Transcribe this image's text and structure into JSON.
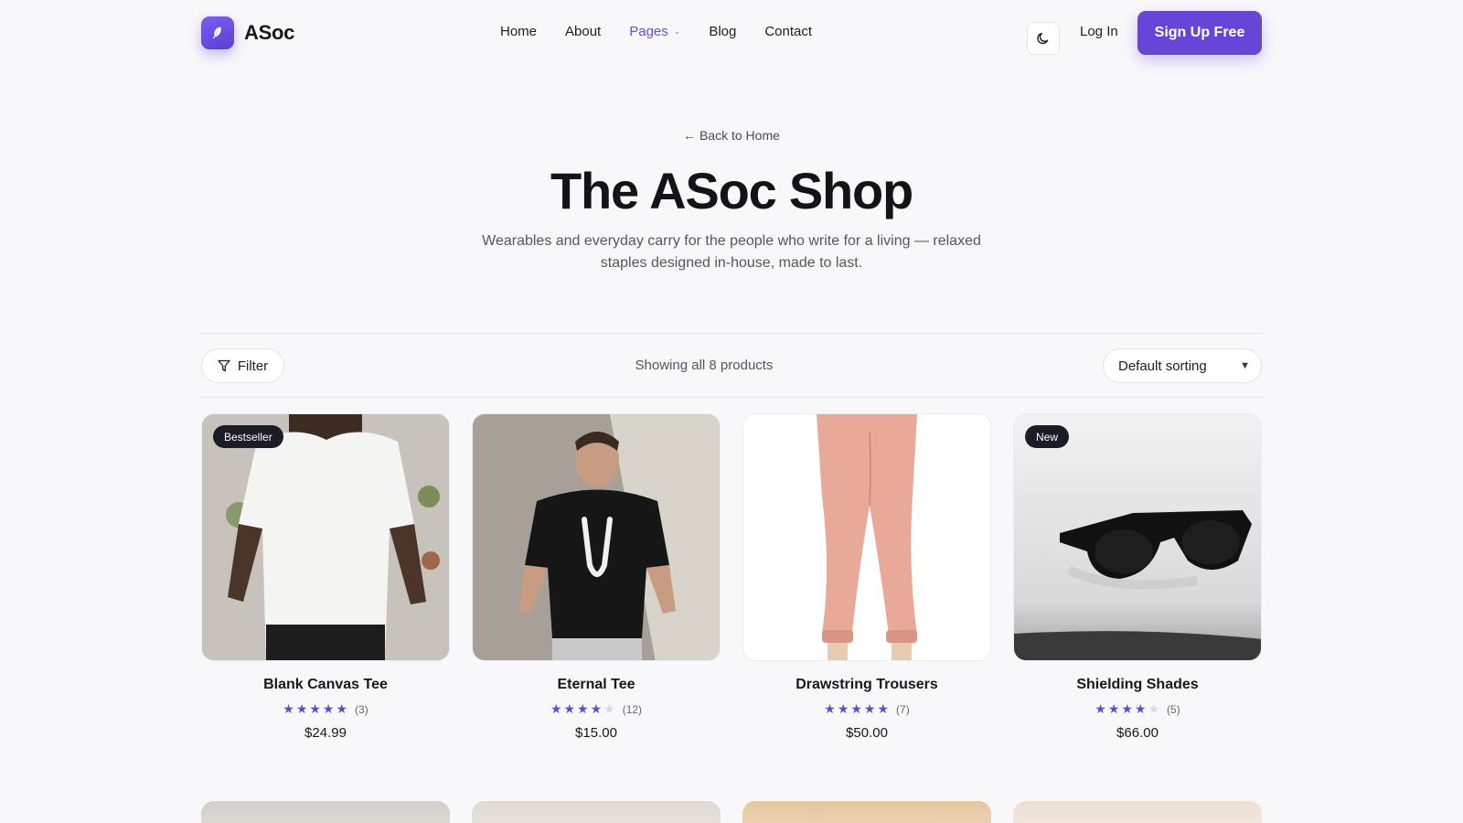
{
  "brand": {
    "name": "ASoc",
    "accent": "#6646d6"
  },
  "nav": {
    "items": [
      {
        "label": "Home"
      },
      {
        "label": "About"
      },
      {
        "label": "Pages"
      },
      {
        "label": "Blog"
      },
      {
        "label": "Contact"
      }
    ],
    "login": "Log In",
    "signup": "Sign Up Free"
  },
  "hero": {
    "back": "← Back to Home",
    "title": "The ASoc Shop",
    "subtitle": "Wearables and everyday carry for the people who write for a living — relaxed staples designed in-house, made to last."
  },
  "toolbar": {
    "filter": "Filter",
    "showing": "Showing all 8 products",
    "sort": "Default sorting"
  },
  "products": [
    {
      "name": "Blank Canvas Tee",
      "badge": "Bestseller",
      "rating": 5,
      "count": "(3)",
      "price": "$24.99"
    },
    {
      "name": "Eternal Tee",
      "badge": "",
      "rating": 4,
      "count": "(12)",
      "price": "$15.00"
    },
    {
      "name": "Drawstring Trousers",
      "badge": "",
      "rating": 5,
      "count": "(7)",
      "price": "$50.00"
    },
    {
      "name": "Shielding Shades",
      "badge": "New",
      "rating": 4,
      "count": "(5)",
      "price": "$66.00"
    }
  ]
}
